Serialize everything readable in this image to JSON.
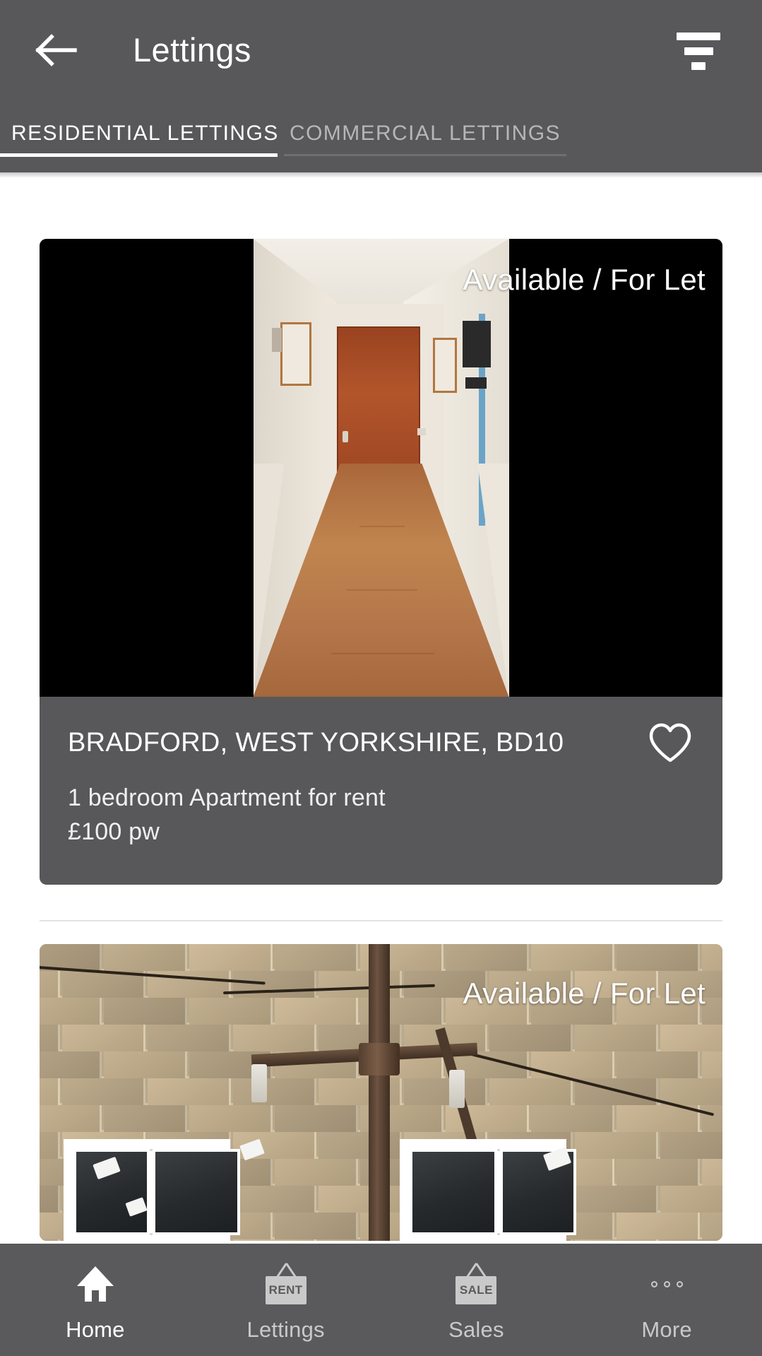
{
  "appbar": {
    "title": "Lettings",
    "back_icon": "arrow-left-icon",
    "filter_icon": "filter-icon"
  },
  "tabs": [
    {
      "label": "RESIDENTIAL LETTINGS",
      "active": true
    },
    {
      "label": "COMMERCIAL LETTINGS",
      "active": false
    }
  ],
  "listings": [
    {
      "status": "Available / For Let",
      "title": "BRADFORD, WEST YORKSHIRE, BD10",
      "subtitle": "1 bedroom Apartment for rent",
      "price": "£100 pw",
      "favourite_icon": "heart-outline-icon",
      "photo": "interior-hallway-photo"
    },
    {
      "status": "Available / For Let",
      "photo": "exterior-brick-wall-photo"
    }
  ],
  "bottom_nav": [
    {
      "label": "Home",
      "icon": "house-icon",
      "active": true
    },
    {
      "label": "Lettings",
      "icon": "rent-sign-icon",
      "badge": "RENT",
      "active": false
    },
    {
      "label": "Sales",
      "icon": "sale-sign-icon",
      "badge": "SALE",
      "active": false
    },
    {
      "label": "More",
      "icon": "more-dots-icon",
      "active": false
    }
  ],
  "colors": {
    "chrome": "#58585a",
    "nav": "#5a5a5c",
    "accent": "#ffffff",
    "inactive_text": "#b6b6b8",
    "page_bg": "#ffffff"
  }
}
